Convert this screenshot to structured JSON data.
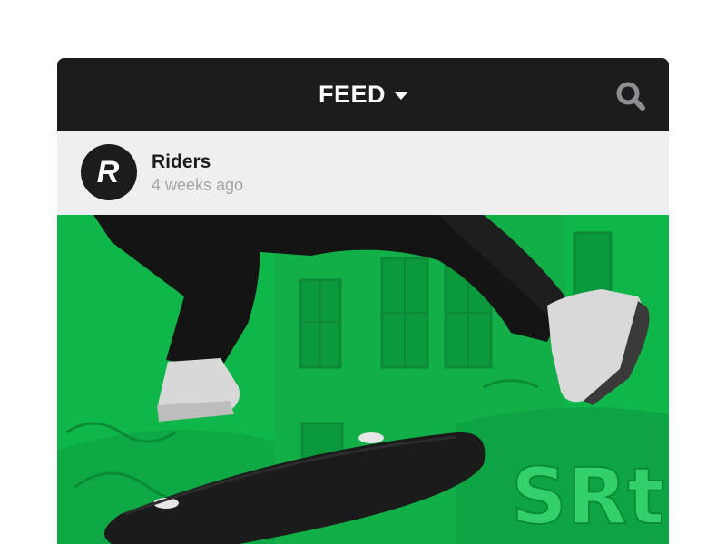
{
  "header": {
    "title": "FEED",
    "dropdown_icon": "caret-down-icon",
    "search_icon": "search-icon"
  },
  "post": {
    "author": "Riders",
    "avatar_letter": "R",
    "timestamp": "4 weeks ago",
    "image_graffiti": "SRt"
  },
  "colors": {
    "header_bg": "#1c1b1d",
    "post_header_bg": "#efeef1",
    "image_tint": "#0fb64a",
    "timestamp_text": "#a5a4a8"
  }
}
